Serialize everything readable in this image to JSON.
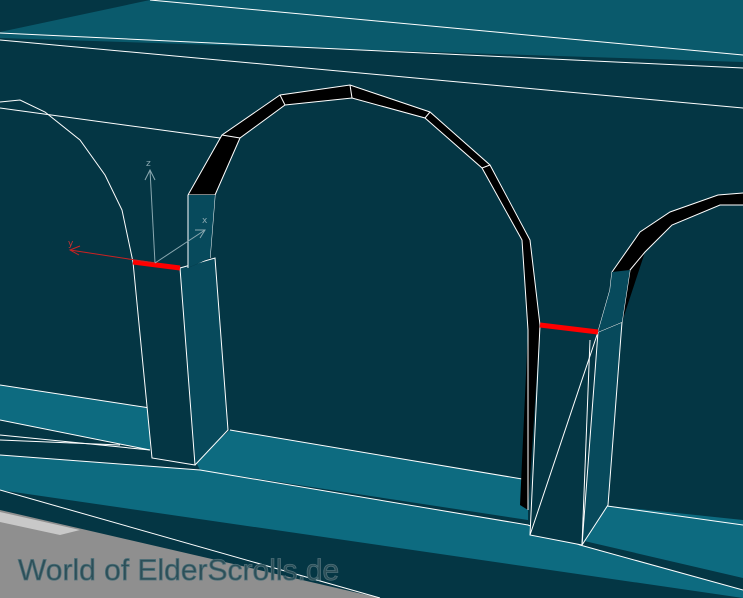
{
  "viewport": {
    "background": "#043644",
    "wireframe_color": "#ffffff",
    "ledge_color": "#0d6b80",
    "inner_face_color": "#074a5c",
    "selected_edge_color": "#ff0000",
    "ground_color": "#8f8f8f"
  },
  "gizmo": {
    "axis_x_label": "x",
    "axis_y_label": "y",
    "axis_z_label": "z"
  },
  "watermark": {
    "text": "World of ElderScrolls.de"
  }
}
